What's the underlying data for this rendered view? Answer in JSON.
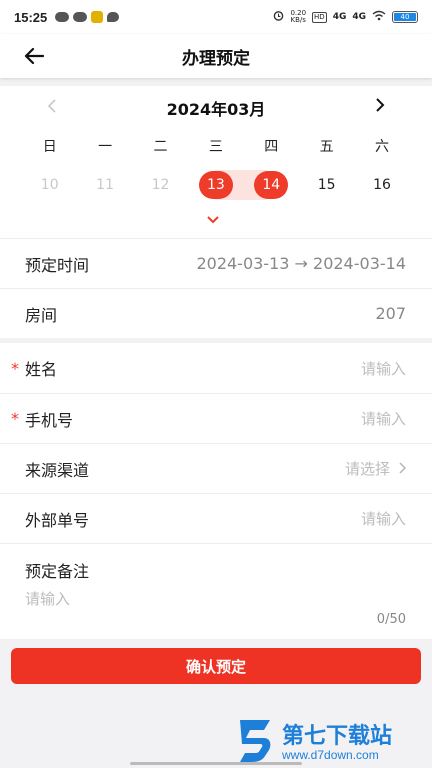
{
  "status_bar": {
    "time": "15:25",
    "net_rate": "0.20\nKB/s",
    "hd_badge": "HD",
    "sig1": "4G",
    "sig2": "4G",
    "battery": "40"
  },
  "header": {
    "title": "办理预定",
    "back_icon": "arrow-left-icon"
  },
  "calendar": {
    "month": "2024年03月",
    "prev_icon": "chevron-left-icon",
    "next_icon": "chevron-right-icon",
    "weekdays": [
      "日",
      "一",
      "二",
      "三",
      "四",
      "五",
      "六"
    ],
    "days": [
      "10",
      "11",
      "12",
      "13",
      "14",
      "15",
      "16"
    ],
    "selected_start": "13",
    "selected_end": "14",
    "toggle_icon": "chevron-down-icon",
    "accent_color": "#ee3b2a"
  },
  "booking": {
    "time_label": "预定时间",
    "time_value": "2024-03-13 → 2024-03-14",
    "room_label": "房间",
    "room_value": "207"
  },
  "form": {
    "name_label": "姓名",
    "name_placeholder": "请输入",
    "phone_label": "手机号",
    "phone_placeholder": "请输入",
    "source_label": "来源渠道",
    "source_placeholder": "请选择",
    "external_label": "外部单号",
    "external_placeholder": "请输入",
    "remark_label": "预定备注",
    "remark_placeholder": "请输入",
    "remark_count": "0/50",
    "required_mark": "*"
  },
  "confirm_button": "确认预定",
  "watermark": {
    "title": "第七下载站",
    "url": "www.d7down.com"
  }
}
